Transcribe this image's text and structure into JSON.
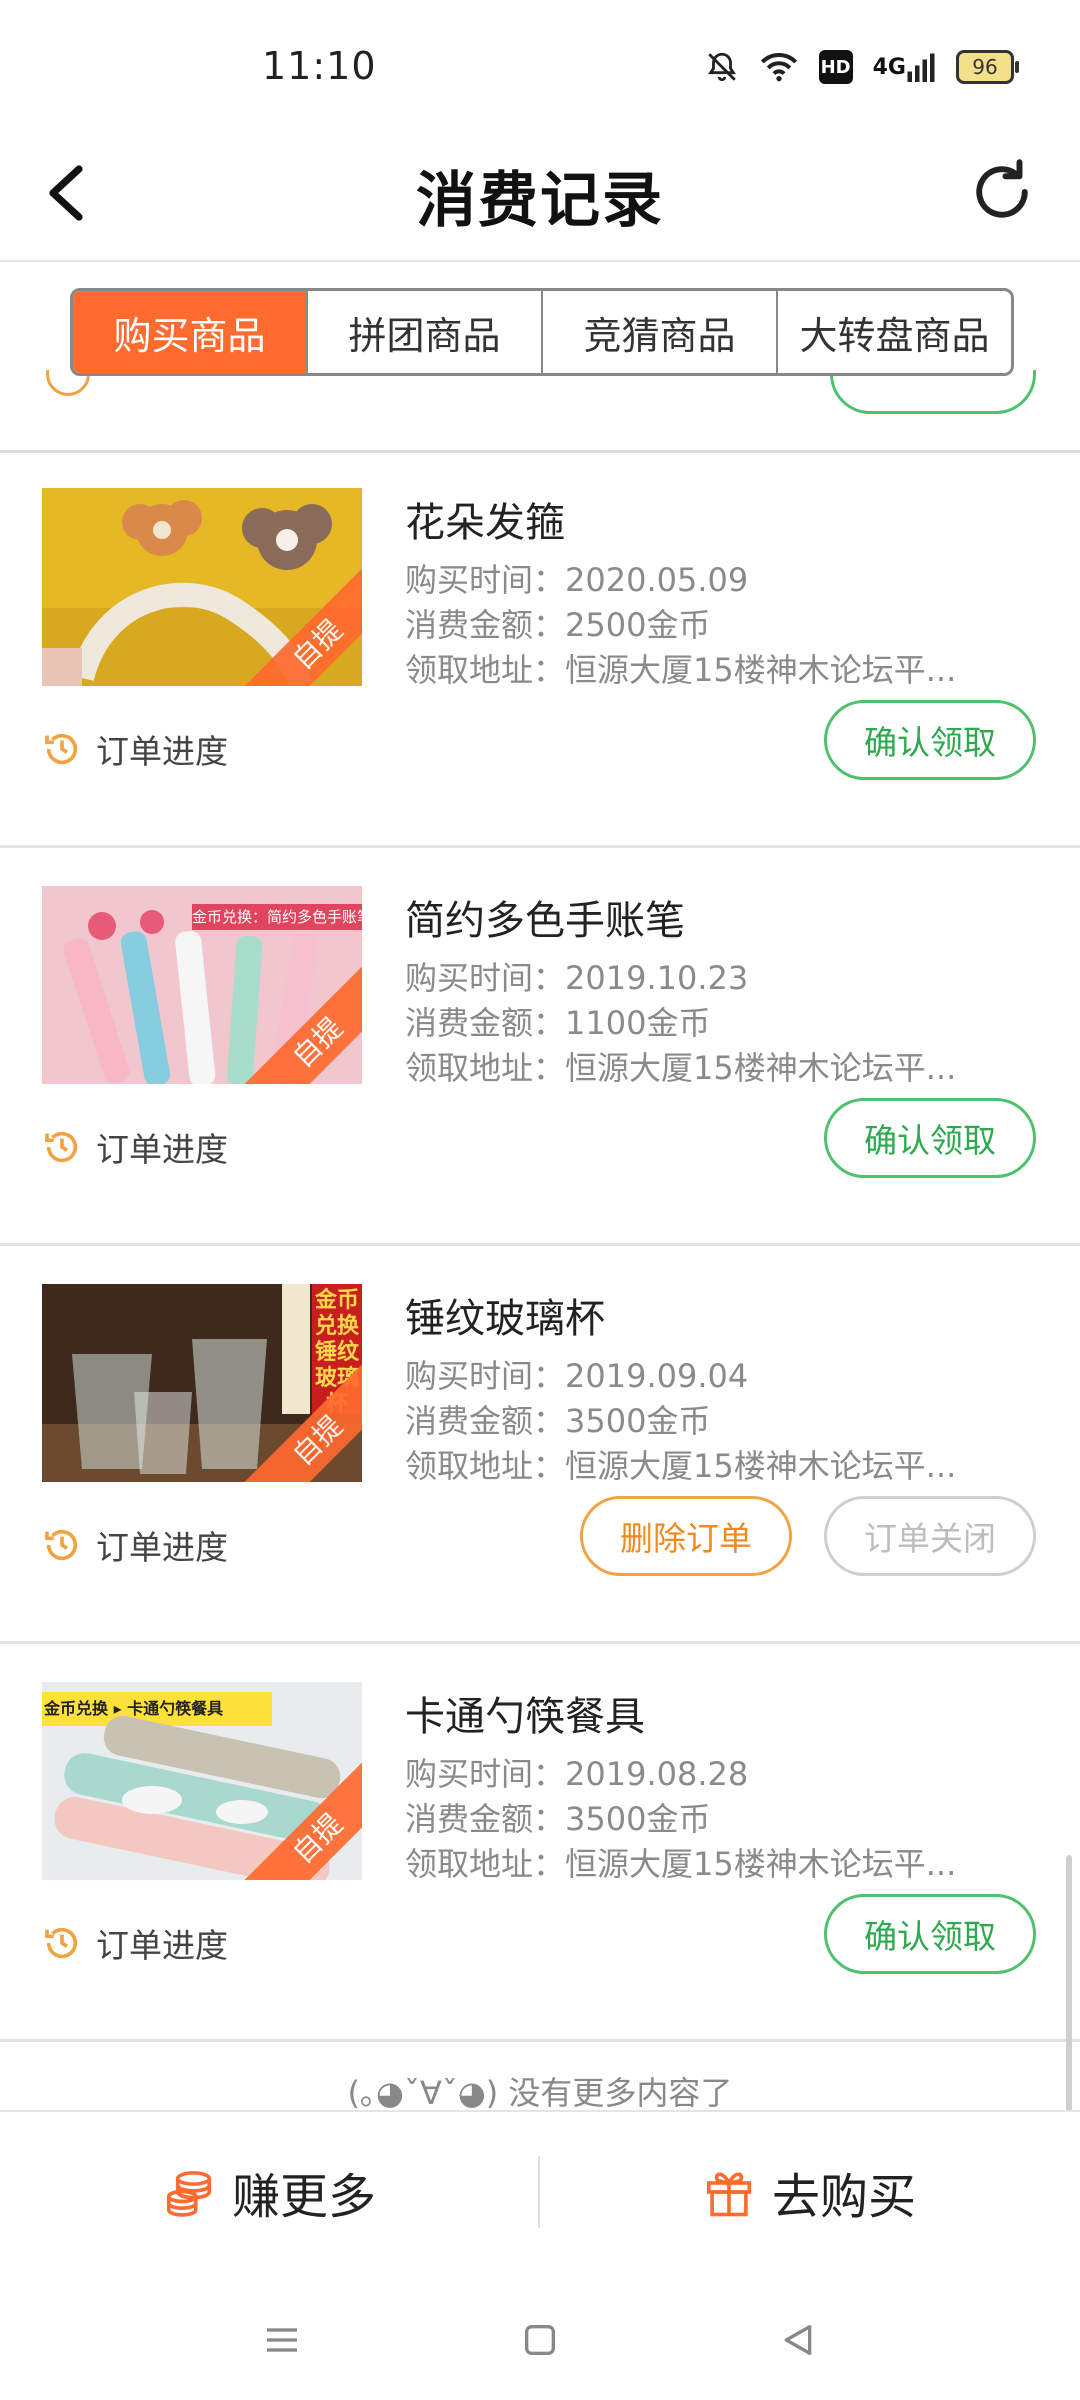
{
  "status_bar": {
    "time": "11:10",
    "hd_label": "HD",
    "network": "4G",
    "battery": "96",
    "icons": [
      "bell-off-icon",
      "wifi-icon",
      "hd-icon",
      "signal-icon",
      "battery-icon"
    ]
  },
  "header": {
    "title": "消费记录",
    "back_icon": "chevron-left-icon",
    "refresh_icon": "refresh-icon"
  },
  "tabs": [
    {
      "label": "购买商品",
      "active": true
    },
    {
      "label": "拼团商品",
      "active": false
    },
    {
      "label": "竞猜商品",
      "active": false
    },
    {
      "label": "大转盘商品",
      "active": false
    }
  ],
  "labels": {
    "order_progress": "订单进度",
    "self_pickup": "自提",
    "confirm_pickup": "确认领取",
    "delete_order": "删除订单",
    "order_closed": "订单关闭"
  },
  "orders": [
    {
      "name": "花朵发箍",
      "purchase_time": "购买时间：2020.05.09",
      "amount": "消费金额：2500金币",
      "address": "领取地址：恒源大厦15楼神木论坛平...",
      "action": "确认领取"
    },
    {
      "name": "简约多色手账笔",
      "purchase_time": "购买时间：2019.10.23",
      "amount": "消费金额：1100金币",
      "address": "领取地址：恒源大厦15楼神木论坛平...",
      "action": "确认领取",
      "image_text": "金币兑换：简约多色手账笔"
    },
    {
      "name": "锤纹玻璃杯",
      "purchase_time": "购买时间：2019.09.04",
      "amount": "消费金额：3500金币",
      "address": "领取地址：恒源大厦15楼神木论坛平...",
      "actions": [
        "删除订单",
        "订单关闭"
      ],
      "image_text": "金币兑换 锤纹玻璃杯"
    },
    {
      "name": "卡通勺筷餐具",
      "purchase_time": "购买时间：2019.08.28",
      "amount": "消费金额：3500金币",
      "address": "领取地址：恒源大厦15楼神木论坛平...",
      "action": "确认领取",
      "image_text": "金币兑换 ▸ 卡通勺筷餐具"
    }
  ],
  "no_more": "(｡◕ˇ∀ˇ◕) 没有更多内容了",
  "bottom_bar": {
    "earn_more": "赚更多",
    "go_buy": "去购买"
  },
  "colors": {
    "accent_orange": "#ff6a2f",
    "green": "#4cc26a",
    "warning_orange": "#f2a240"
  }
}
